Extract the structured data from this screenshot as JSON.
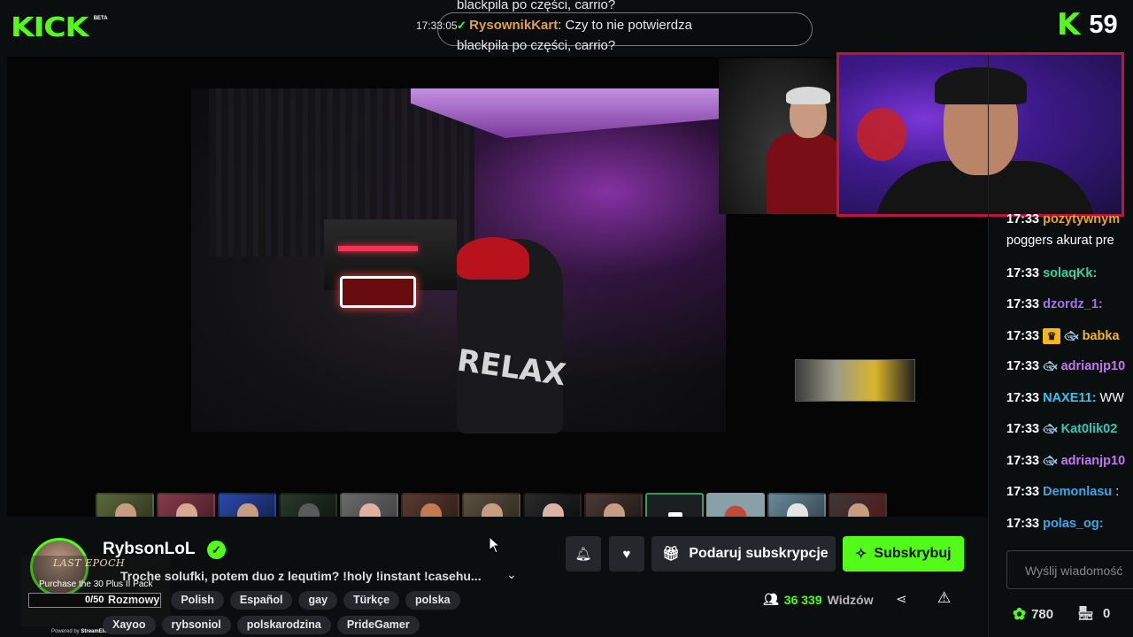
{
  "brand": {
    "logo": "KICK",
    "beta": "BETA"
  },
  "overlay_chat": {
    "line_top": "blackpila po części, carrio?",
    "time": "17:33:05",
    "user": "RysownikKart",
    "message": ": Czy to nie potwierdza",
    "line_bottom": "blackpila po części, carrio?"
  },
  "top_right": {
    "count": "59"
  },
  "thumbnails": [
    "guest-1",
    "guest-2",
    "guest-3",
    "guest-4",
    "guest-5",
    "guest-6",
    "guest-7",
    "guest-8",
    "guest-9",
    "guest-10",
    "guest-11",
    "guest-12",
    "guest-13"
  ],
  "ad": {
    "title": "LAST EPOCH",
    "item": "Purchase the 30 Plus II Pack",
    "progress": 0,
    "count": "0/50",
    "powered": "Powered by",
    "powered_brand": "StreamElements"
  },
  "channel": {
    "name": "RybsonLoL",
    "title": "Troche solufki, potem duo z lequtim? !holy !instant !casehu...",
    "tags": [
      "Rozmowy",
      "Polish",
      "Español",
      "gay",
      "Türkçe",
      "polska",
      "Xayoo",
      "rybsoniol",
      "polskarodzina",
      "PrideGamer"
    ]
  },
  "actions": {
    "gift_label": "Podaruj subskrypcje",
    "subscribe_label": "Subskrybuj"
  },
  "viewers": {
    "count": "36 339",
    "label": "Widzów"
  },
  "chat": {
    "messages": [
      {
        "time": "17:33",
        "user": "pozytywnym",
        "color": "#e8a61c",
        "badges": [],
        "text": ""
      },
      {
        "time": "",
        "user": "",
        "color": "#ffffff",
        "badges": [],
        "text": "poggers akurat pre"
      },
      {
        "time": "17:33",
        "user": "solaqKk:",
        "color": "#2fd3a0",
        "badges": [],
        "text": ""
      },
      {
        "time": "17:33",
        "user": "dzordz_1:",
        "color": "#a273e6",
        "badges": [],
        "text": ""
      },
      {
        "time": "17:33",
        "user": "babka",
        "color": "#f2b81d",
        "badges": [
          "crown",
          "fish"
        ],
        "text": ""
      },
      {
        "time": "17:33",
        "user": "adrianjp10",
        "color": "#c07aee",
        "badges": [
          "fish"
        ],
        "text": ""
      },
      {
        "time": "17:33",
        "user": "NAXE11:",
        "color": "#34c6f0",
        "badges": [],
        "text": "WW"
      },
      {
        "time": "17:33",
        "user": "Kat0lik02",
        "color": "#33c6b6",
        "badges": [
          "fish"
        ],
        "text": ""
      },
      {
        "time": "17:33",
        "user": "adrianjp10",
        "color": "#c07aee",
        "badges": [
          "fish"
        ],
        "text": ""
      },
      {
        "time": "17:33",
        "user": "Demonlasu",
        "color": "#3ea5e6",
        "badges": [],
        "text": ":"
      },
      {
        "time": "17:33",
        "user": "polas_og:",
        "color": "#3ea5e6",
        "badges": [],
        "text": ""
      }
    ],
    "input_placeholder": "Wyślij wiadomość",
    "points": "780",
    "store_count": "0"
  }
}
